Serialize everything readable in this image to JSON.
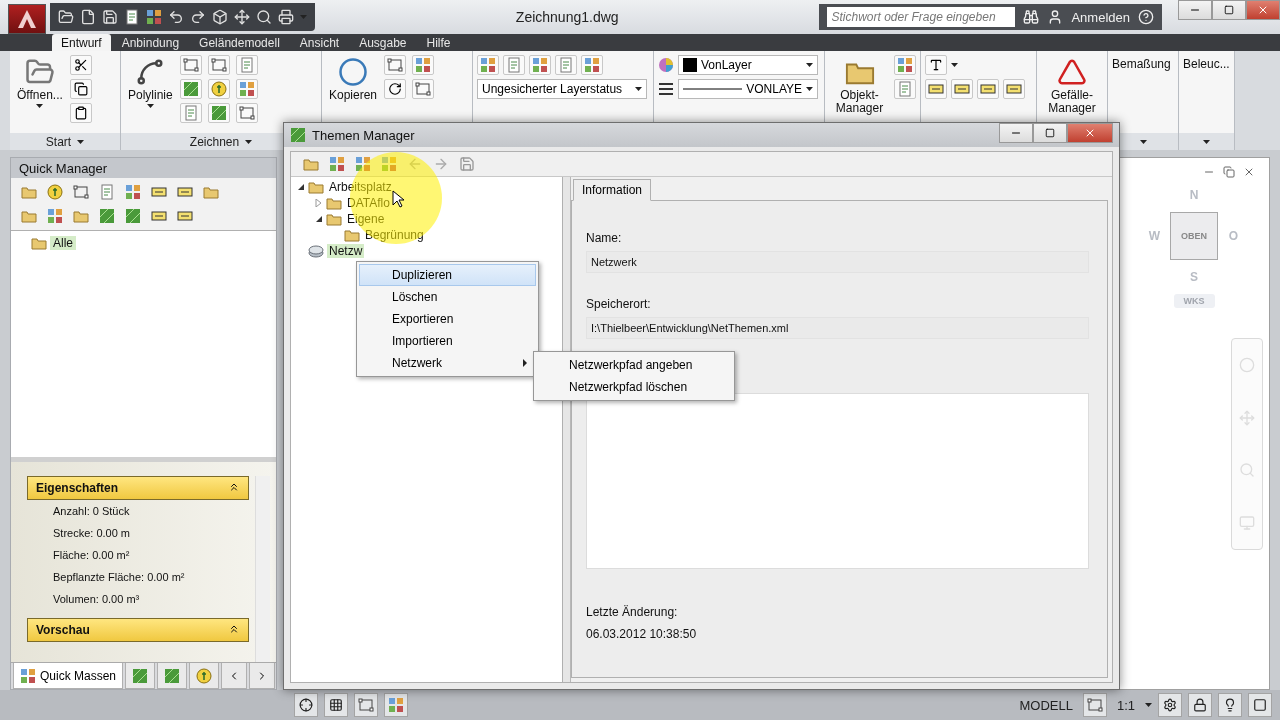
{
  "app": {
    "title": "Zeichnung1.dwg",
    "search": {
      "placeholder": "Stichwort oder Frage eingeben"
    },
    "sign_in": "Anmelden"
  },
  "ribbon_tabs": [
    {
      "label": "Entwurf",
      "selected": true
    },
    {
      "label": "Anbindung",
      "selected": false
    },
    {
      "label": "Geländemodell",
      "selected": false
    },
    {
      "label": "Ansicht",
      "selected": false
    },
    {
      "label": "Ausgabe",
      "selected": false
    },
    {
      "label": "Hilfe",
      "selected": false
    }
  ],
  "ribbon": {
    "open_button": "Öffnen...",
    "polyline_button": "Polylinie",
    "copy_button": "Kopieren",
    "layer_state": "Ungesicherter Layerstatus",
    "color_dropdown": "VonLayer",
    "linetype_dropdown": "VONLAYE",
    "object_manager_button": "Objekt-Manager",
    "slope_manager_button": "Gefälle-Manager",
    "dimension_panel": "Bemaßung",
    "lighting_panel": "Beleuc...",
    "panel_titles": [
      "Start",
      "Zeichnen"
    ]
  },
  "quick_manager": {
    "title": "Quick Manager",
    "tree": [
      {
        "label": "Alle",
        "selected": true
      }
    ],
    "sections": [
      {
        "title": "Eigenschaften",
        "expanded": true,
        "lines": [
          "Anzahl: 0 Stück",
          "Strecke: 0.00 m",
          "Fläche: 0.00 m²",
          "Bepflanzte Fläche: 0.00 m²",
          "Volumen: 0.00 m³"
        ]
      },
      {
        "title": "Vorschau",
        "expanded": true
      }
    ],
    "tabs": [
      {
        "label": "Quick Massen",
        "selected": true
      }
    ]
  },
  "viewcube": {
    "north": "N",
    "west": "W",
    "face": "OBEN",
    "east": "O",
    "south": "S",
    "ucs": "WKS"
  },
  "dialog": {
    "title": "Themen Manager",
    "tree": [
      {
        "label": "Arbeitsplatz",
        "kind": "folder",
        "expanded": true,
        "selected": false,
        "children": [
          {
            "label": "DATAflo",
            "kind": "folder",
            "expanded": false,
            "selected": false
          },
          {
            "label": "Eigene",
            "kind": "folder",
            "expanded": true,
            "selected": false,
            "children": [
              {
                "label": "Begrünung",
                "kind": "folder",
                "selected": false
              }
            ]
          }
        ]
      },
      {
        "label": "Netzw",
        "kind": "network",
        "selected": true
      }
    ],
    "tabs": [
      {
        "label": "Information",
        "selected": true
      }
    ],
    "fields": [
      {
        "label": "Name:",
        "value": "Netzwerk"
      },
      {
        "label": "Speicherort:",
        "value": "I:\\Thielbeer\\Entwicklung\\NetThemen.xml"
      }
    ],
    "modified": {
      "label": "Letzte Änderung:",
      "value": "06.03.2012 10:38:50"
    },
    "context_menu": [
      {
        "label": "Duplizieren",
        "selected": true,
        "submenu": false
      },
      {
        "label": "Löschen",
        "selected": false,
        "submenu": false
      },
      {
        "label": "Exportieren",
        "selected": false,
        "submenu": false
      },
      {
        "label": "Importieren",
        "selected": false,
        "submenu": false
      },
      {
        "label": "Netzwerk",
        "selected": false,
        "submenu": true
      }
    ],
    "submenu": [
      {
        "label": "Netzwerkpfad angeben",
        "selected": false
      },
      {
        "label": "Netzwerkpfad löschen",
        "selected": false
      }
    ]
  },
  "status_bar": {
    "mode": "MODELL",
    "scale": "1:1"
  }
}
